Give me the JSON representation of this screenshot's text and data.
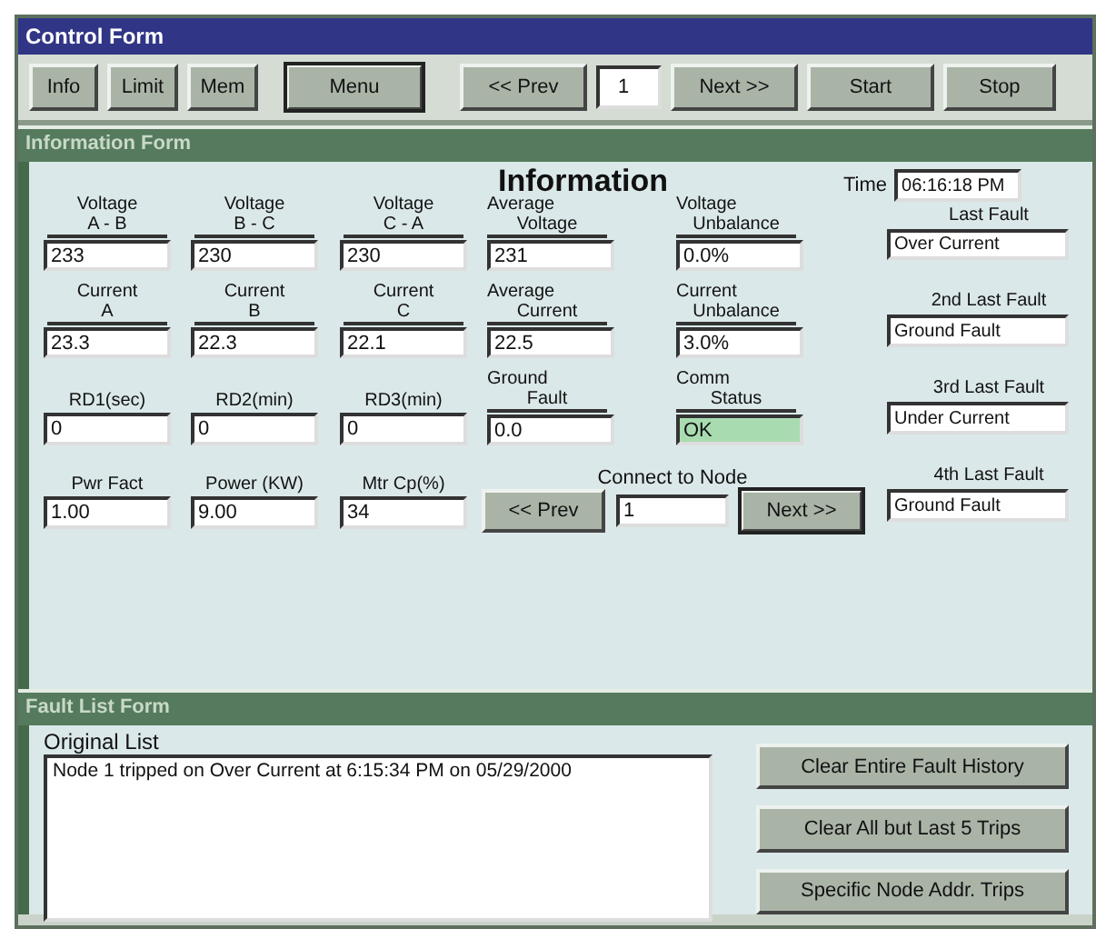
{
  "window": {
    "title": "Control Form"
  },
  "toolbar": [
    {
      "kind": "button",
      "label": "Info",
      "default": false
    },
    {
      "kind": "button",
      "label": "Limit",
      "default": false
    },
    {
      "kind": "button",
      "label": "Mem",
      "default": false
    },
    {
      "kind": "button",
      "label": "Menu",
      "default": true
    },
    {
      "kind": "button",
      "label": "<< Prev",
      "default": false
    },
    {
      "kind": "field",
      "value": "1"
    },
    {
      "kind": "button",
      "label": "Next >>",
      "default": false
    },
    {
      "kind": "button",
      "label": "Start",
      "default": false
    },
    {
      "kind": "button",
      "label": "Stop",
      "default": false
    }
  ],
  "info_form": {
    "title": "Information Form",
    "heading": "Information",
    "time_label": "Time",
    "time_value": "06:16:18 PM",
    "rows": [
      [
        {
          "label": [
            "Voltage",
            "A - B"
          ],
          "value": "233",
          "highlight": false
        },
        {
          "label": [
            "Voltage",
            "B - C"
          ],
          "value": "230",
          "highlight": false
        },
        {
          "label": [
            "Voltage",
            "C - A"
          ],
          "value": "230",
          "highlight": false
        },
        {
          "label": [
            "Average",
            "Voltage"
          ],
          "value": "231",
          "highlight": false
        },
        {
          "label": [
            "Voltage",
            "Unbalance"
          ],
          "value": "0.0%",
          "highlight": false
        }
      ],
      [
        {
          "label": [
            "Current",
            "A"
          ],
          "value": "23.3",
          "highlight": false
        },
        {
          "label": [
            "Current",
            "B"
          ],
          "value": "22.3",
          "highlight": false
        },
        {
          "label": [
            "Current",
            "C"
          ],
          "value": "22.1",
          "highlight": false
        },
        {
          "label": [
            "Average",
            "Current"
          ],
          "value": "22.5",
          "highlight": false
        },
        {
          "label": [
            "Current",
            "Unbalance"
          ],
          "value": "3.0%",
          "highlight": false
        }
      ],
      [
        {
          "label": [
            "RD1(sec)"
          ],
          "value": "0",
          "highlight": false
        },
        {
          "label": [
            "RD2(min)"
          ],
          "value": "0",
          "highlight": false
        },
        {
          "label": [
            "RD3(min)"
          ],
          "value": "0",
          "highlight": false
        },
        {
          "label": [
            "Ground",
            "Fault"
          ],
          "value": "0.0",
          "highlight": false
        },
        {
          "label": [
            "Comm",
            "Status"
          ],
          "value": "OK",
          "highlight": true
        }
      ],
      [
        {
          "label": [
            "Pwr Fact"
          ],
          "value": "1.00",
          "highlight": false
        },
        {
          "label": [
            "Power (KW)"
          ],
          "value": "9.00",
          "highlight": false
        },
        {
          "label": [
            "Mtr Cp(%)"
          ],
          "value": "34",
          "highlight": false
        }
      ]
    ],
    "node_nav": {
      "label": "Connect to Node",
      "prev": "<< Prev",
      "value": "1",
      "next": "Next >>"
    },
    "faults": [
      {
        "label": "Last Fault",
        "value": "Over Current"
      },
      {
        "label": "2nd Last Fault",
        "value": "Ground Fault"
      },
      {
        "label": "3rd Last Fault",
        "value": "Under Current"
      },
      {
        "label": "4th Last Fault",
        "value": "Ground Fault"
      }
    ]
  },
  "fault_form": {
    "title": "Fault List Form",
    "list_label": "Original List",
    "entries": [
      "Node 1 tripped on Over Current at 6:15:34 PM on 05/29/2000"
    ],
    "buttons": [
      "Clear Entire Fault History",
      "Clear All but Last 5 Trips",
      "Specific Node Addr. Trips"
    ]
  }
}
